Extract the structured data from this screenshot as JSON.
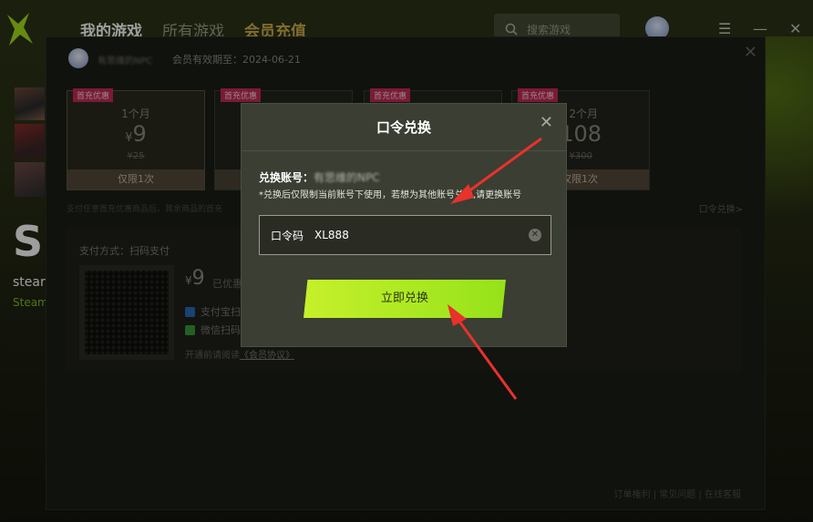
{
  "nav": {
    "my_games": "我的游戏",
    "all_games": "所有游戏",
    "vip_recharge": "会员充值"
  },
  "search": {
    "placeholder": "搜索游戏"
  },
  "left": {
    "big_letter": "S",
    "game_name": "stear",
    "game_sub": "Steam"
  },
  "vip": {
    "user": "有思维的NPC",
    "expire": "会员有效期至：2024-06-21",
    "plans": [
      {
        "tag": "首充优惠",
        "name": "1个月",
        "currency": "¥",
        "price": "9",
        "orig": "¥25",
        "limit": "仅限1次"
      },
      {
        "tag": "首充优惠",
        "name": "",
        "currency": "",
        "price": "",
        "orig": "",
        "limit": ""
      },
      {
        "tag": "首充优惠",
        "name": "",
        "currency": "",
        "price": "",
        "orig": "",
        "limit": ""
      },
      {
        "tag": "首充优惠",
        "name": "2个月",
        "currency": "",
        "price": "108",
        "orig": "¥300",
        "limit": "仅限1次"
      }
    ],
    "note": "支付任意首充优惠商品后，其余商品的首充",
    "redeem_link": "口令兑换>",
    "pay_method": "支付方式：扫码支付",
    "pay_currency": "¥",
    "pay_price": "9",
    "pay_saved": "已优惠",
    "alipay": "支付宝扫",
    "wechat": "微信扫码",
    "agreement_prefix": "开通前请阅读",
    "agreement_link": "《会员协议》",
    "footer": "订单権利 | 常见问题 | 在线客服"
  },
  "modal": {
    "title": "口令兑换",
    "account_label": "兑换账号：",
    "account_value": "有思维的NPC",
    "hint": "*兑换后仅限制当前账号下使用，若想为其他账号兑换,请更换账号",
    "code_label": "口令码",
    "code_value": "XL888",
    "redeem_button": "立即兑换"
  },
  "colors": {
    "accent_green": "#a8e61e",
    "vip_gold": "#d2b04a",
    "arrow_red": "#e8322b"
  }
}
